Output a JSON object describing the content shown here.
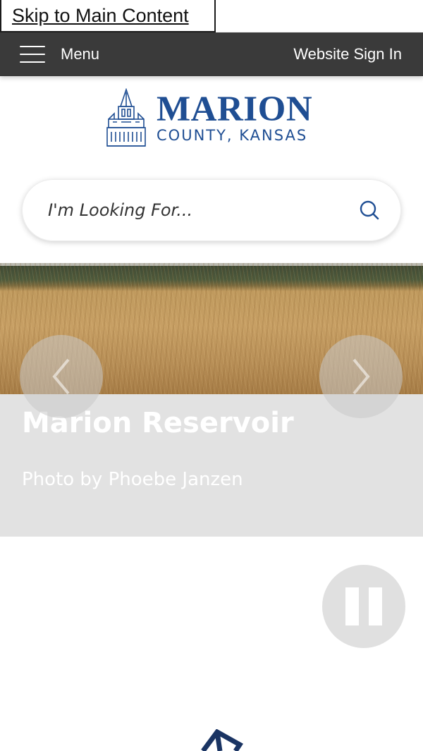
{
  "skip_link": {
    "label": "Skip to Main Content"
  },
  "topbar": {
    "menu_label": "Menu",
    "signin_label": "Website Sign In"
  },
  "logo": {
    "title": "MARION",
    "subtitle": "COUNTY, KANSAS",
    "color": "#1f4e93"
  },
  "search": {
    "placeholder": "I'm Looking For..."
  },
  "hero": {
    "title": "Marion Reservoir",
    "credit": "Photo by Phoebe Janzen",
    "prev_icon": "chevron-left-icon",
    "next_icon": "chevron-right-icon"
  },
  "slideshow": {
    "control_icon": "pause-icon"
  },
  "colors": {
    "topbar": "#3a3a3a",
    "caption_bg": "#e2e2e2",
    "accent": "#1f4e93"
  }
}
